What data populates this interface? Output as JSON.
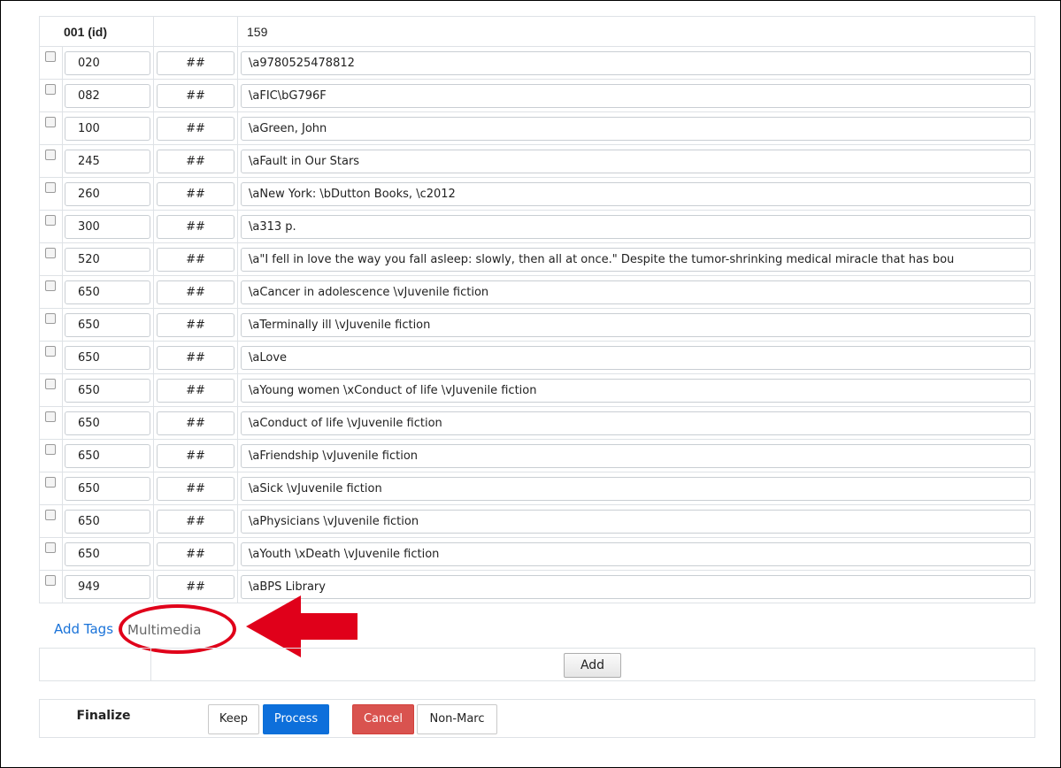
{
  "record": {
    "id_label": "001 (id)",
    "id_value": "159",
    "fields": [
      {
        "tag": "020",
        "ind": "##",
        "value": "\\a9780525478812"
      },
      {
        "tag": "082",
        "ind": "##",
        "value": "\\aFIC\\bG796F"
      },
      {
        "tag": "100",
        "ind": "##",
        "value": "\\aGreen, John"
      },
      {
        "tag": "245",
        "ind": "##",
        "value": "\\aFault in Our Stars"
      },
      {
        "tag": "260",
        "ind": "##",
        "value": "\\aNew York: \\bDutton Books, \\c2012"
      },
      {
        "tag": "300",
        "ind": "##",
        "value": "\\a313 p."
      },
      {
        "tag": "520",
        "ind": "##",
        "value": "\\a\"I fell in love the way you fall asleep: slowly, then all at once.\"  Despite the tumor-shrinking medical miracle that has bou"
      },
      {
        "tag": "650",
        "ind": "##",
        "value": "\\aCancer in adolescence \\vJuvenile fiction"
      },
      {
        "tag": "650",
        "ind": "##",
        "value": "\\aTerminally ill \\vJuvenile fiction"
      },
      {
        "tag": "650",
        "ind": "##",
        "value": "\\aLove"
      },
      {
        "tag": "650",
        "ind": "##",
        "value": "\\aYoung women \\xConduct of life \\vJuvenile fiction"
      },
      {
        "tag": "650",
        "ind": "##",
        "value": "\\aConduct of life \\vJuvenile fiction"
      },
      {
        "tag": "650",
        "ind": "##",
        "value": "\\aFriendship \\vJuvenile fiction"
      },
      {
        "tag": "650",
        "ind": "##",
        "value": "\\aSick \\vJuvenile fiction"
      },
      {
        "tag": "650",
        "ind": "##",
        "value": "\\aPhysicians \\vJuvenile fiction"
      },
      {
        "tag": "650",
        "ind": "##",
        "value": "\\aYouth \\xDeath \\vJuvenile fiction"
      },
      {
        "tag": "949",
        "ind": "##",
        "value": "\\aBPS Library"
      }
    ]
  },
  "tabs": {
    "add_tags": "Add Tags",
    "multimedia": "Multimedia"
  },
  "add_button": "Add",
  "finalize": {
    "label": "Finalize",
    "keep": "Keep",
    "process": "Process",
    "cancel": "Cancel",
    "non_marc": "Non-Marc"
  },
  "colors": {
    "link": "#1a73d9",
    "primary": "#0d6fdb",
    "danger": "#d9534f",
    "annotation": "#e0001a"
  }
}
